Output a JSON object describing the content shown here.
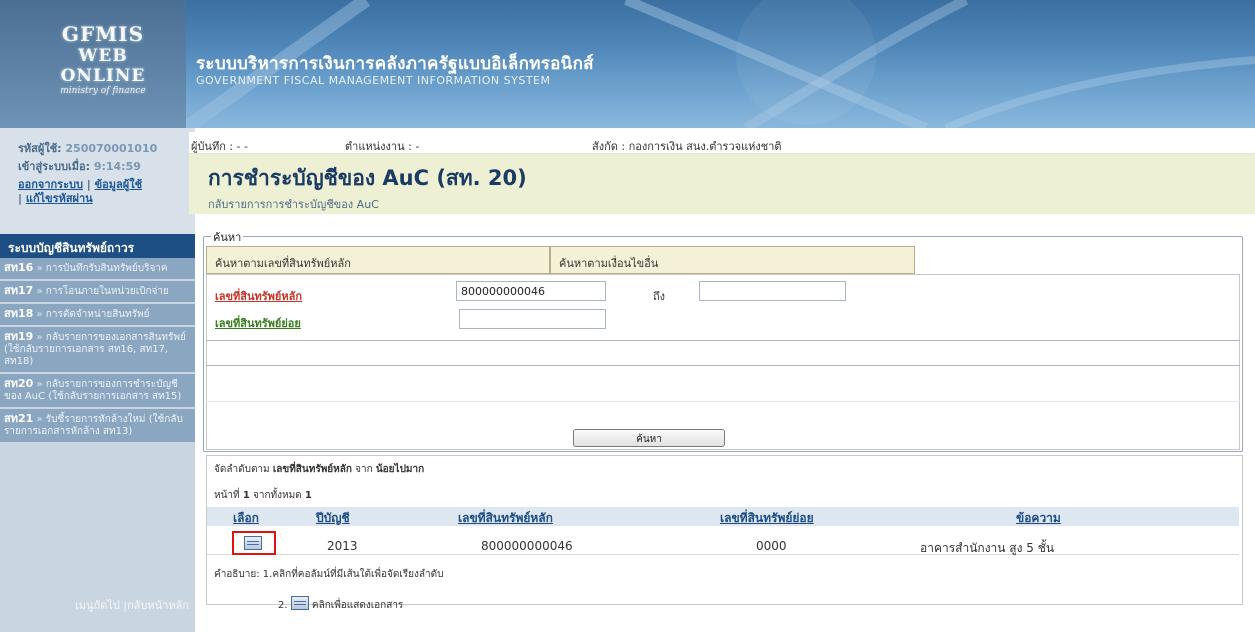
{
  "header": {
    "logo_line1": "GFMIS",
    "logo_line2": "WEB ONLINE",
    "logo_line3": "ministry of finance",
    "system_title_th": "ระบบบริหารการเงินการคลังภาครัฐแบบอิเล็กทรอนิกส์",
    "system_title_en": "GOVERNMENT FISCAL MANAGEMENT INFORMATION SYSTEM"
  },
  "user": {
    "user_label": "รหัสผู้ใช้:",
    "user_id": "250070001010",
    "login_label": "เข้าสู่ระบบเมื่อ:",
    "login_time": "9:14:59",
    "logout_link": "ออกจากระบบ",
    "sep": "|",
    "profile_link": "ข้อมูลผู้ใช้",
    "password_link": "แก้ไขรหัสผ่าน"
  },
  "sidebar": {
    "heading": "ระบบบัญชีสินทรัพย์ถาวร",
    "items": [
      {
        "code": "สท16",
        "text": "การบันทึกรับสินทรัพย์บริจาค"
      },
      {
        "code": "สท17",
        "text": "การโอนภายในหน่วยเบิกจ่าย"
      },
      {
        "code": "สท18",
        "text": "การตัดจำหน่ายสินทรัพย์"
      },
      {
        "code": "สท19",
        "text": "กลับรายการของเอกสารสินทรัพย์ (ใช้กลับรายการเอกสาร สท16, สท17, สท18)"
      },
      {
        "code": "สท20",
        "text": "กลับรายการของการชำระบัญชีของ AuC (ใช้กลับรายการเอกสาร สท15)"
      },
      {
        "code": "สท21",
        "text": "รับชี้รายการหักล้างใหม่ (ใช้กลับรายการเอกสารหักล้าง สท13)"
      }
    ],
    "arrow": "»",
    "footer": "เมนูถัดไป |กลับหน้าหลัก"
  },
  "infobar": {
    "recorder_label": "ผู้บันทึก : - -",
    "position_label": "ตำแหน่งงาน : -",
    "affiliation_label": "สังกัด : กองการเงิน สนง.ตำรวจแห่งชาติ"
  },
  "page": {
    "title": "การชำระบัญชีของ AuC (สท. 20)",
    "subtitle": "กลับรายการการชำระบัญชีของ AuC"
  },
  "search": {
    "legend": "ค้นหา",
    "tab_main_asset": "ค้นหาตามเลขที่สินทรัพย์หลัก",
    "tab_other": "ค้นหาตามเงื่อนไขอื่น",
    "main_asset_label": "เลขที่สินทรัพย์หลัก",
    "main_asset_value": "800000000046",
    "to_label": "ถึง",
    "to_value": "",
    "sub_asset_label": "เลขที่สินทรัพย์ย่อย",
    "sub_asset_value": "",
    "search_button": "ค้นหา"
  },
  "results": {
    "sort_prefix": "จัดลำดับตาม",
    "sort_field": "เลขที่สินทรัพย์หลัก",
    "sort_mid": "จาก",
    "sort_order": "น้อยไปมาก",
    "page_prefix": "หน้าที่",
    "page_current": "1",
    "page_mid": "จากทั้งหมด",
    "page_total": "1",
    "columns": [
      "เลือก",
      "ปีบัญชี",
      "เลขที่สินทรัพย์หลัก",
      "เลขที่สินทรัพย์ย่อย",
      "ข้อความ"
    ],
    "rows": [
      {
        "year": "2013",
        "main_asset": "800000000046",
        "sub_asset": "0000",
        "text": "อาคารสำนักงาน สูง 5 ชั้น"
      }
    ],
    "note_label": "คำอธิบาย:",
    "note1": "1.คลิกที่คอลัมน์ที่มีเส้นใต้เพื่อจัดเรียงลำดับ",
    "note2_num": "2.",
    "note2_text": "คลิกเพื่อแสดงเอกสาร"
  },
  "colors": {
    "header_blue": "#4f86b8",
    "sidebar_menu_head": "#1d4f84",
    "title_bg": "#eef0d4",
    "required_label": "#c0392b",
    "optional_label": "#3a7d1e",
    "highlight_red": "#e11212"
  }
}
